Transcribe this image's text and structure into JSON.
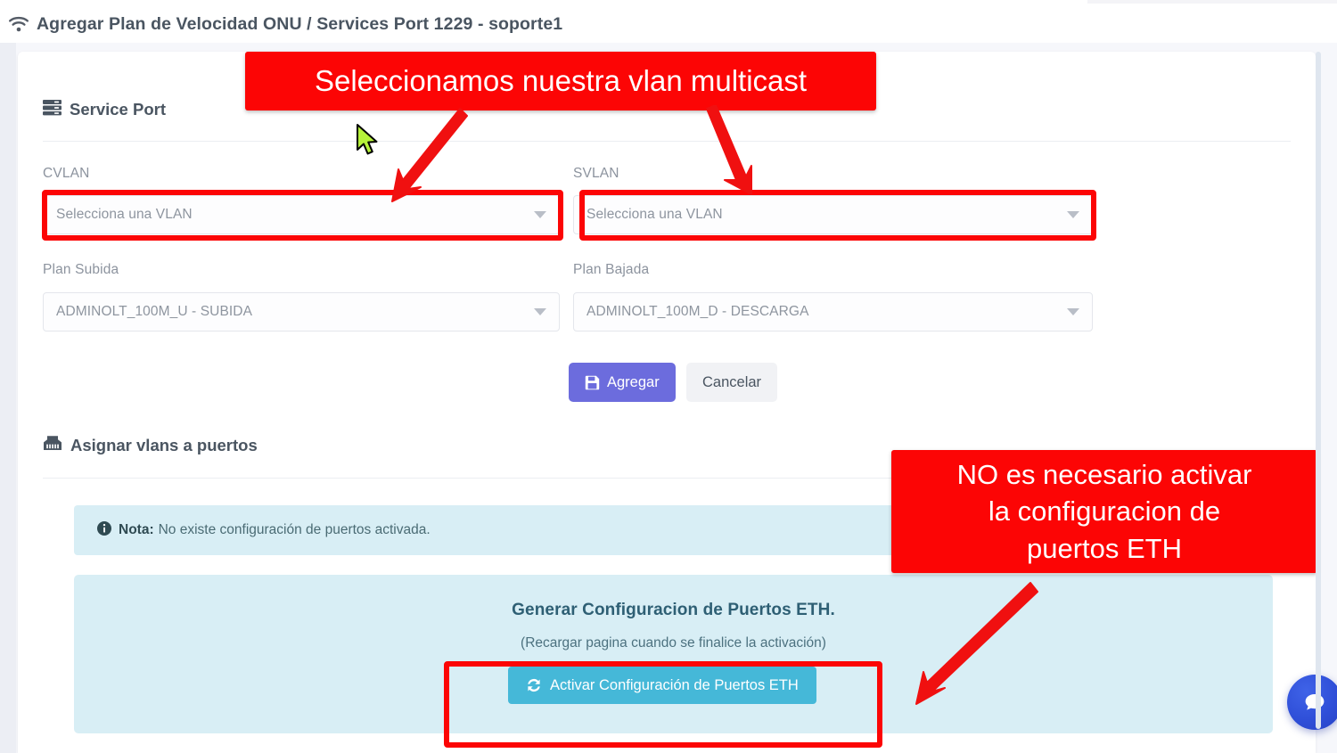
{
  "header": {
    "icon": "wifi-icon",
    "title": "Agregar Plan de Velocidad ONU / Services Port 1229 - soporte1"
  },
  "service_port": {
    "icon": "server-rack-icon",
    "heading": "Service Port",
    "fields": {
      "cvlan_label": "CVLAN",
      "cvlan_value": "Selecciona una VLAN",
      "svlan_label": "SVLAN",
      "svlan_value": "Selecciona una VLAN",
      "plan_subida_label": "Plan Subida",
      "plan_subida_value": "ADMINOLT_100M_U - SUBIDA",
      "plan_bajada_label": "Plan Bajada",
      "plan_bajada_value": "ADMINOLT_100M_D - DESCARGA"
    },
    "actions": {
      "submit_label": "Agregar",
      "submit_icon": "save-icon",
      "cancel_label": "Cancelar"
    }
  },
  "assign_vlans": {
    "icon": "ethernet-port-icon",
    "heading": "Asignar vlans a puertos",
    "note": {
      "icon": "info-circle-icon",
      "strong": "Nota:",
      "text": "No existe configuración de puertos activada."
    },
    "eth_panel": {
      "title": "Generar Configuracion de Puertos ETH.",
      "subtitle": "(Recargar pagina cuando se finalice la activación)",
      "button_label": "Activar Configuración de Puertos ETH",
      "button_icon": "refresh-sync-icon"
    }
  },
  "annotations": {
    "callout_top": "Seleccionamos nuestra vlan multicast",
    "callout_right_line1": "NO es necesario activar",
    "callout_right_line2": "la configuracion de",
    "callout_right_line3": "puertos ETH",
    "color": "#fc0505"
  },
  "widgets": {
    "chat_icon": "chat-bubble-icon",
    "chat_color": "#2f4fd8"
  }
}
